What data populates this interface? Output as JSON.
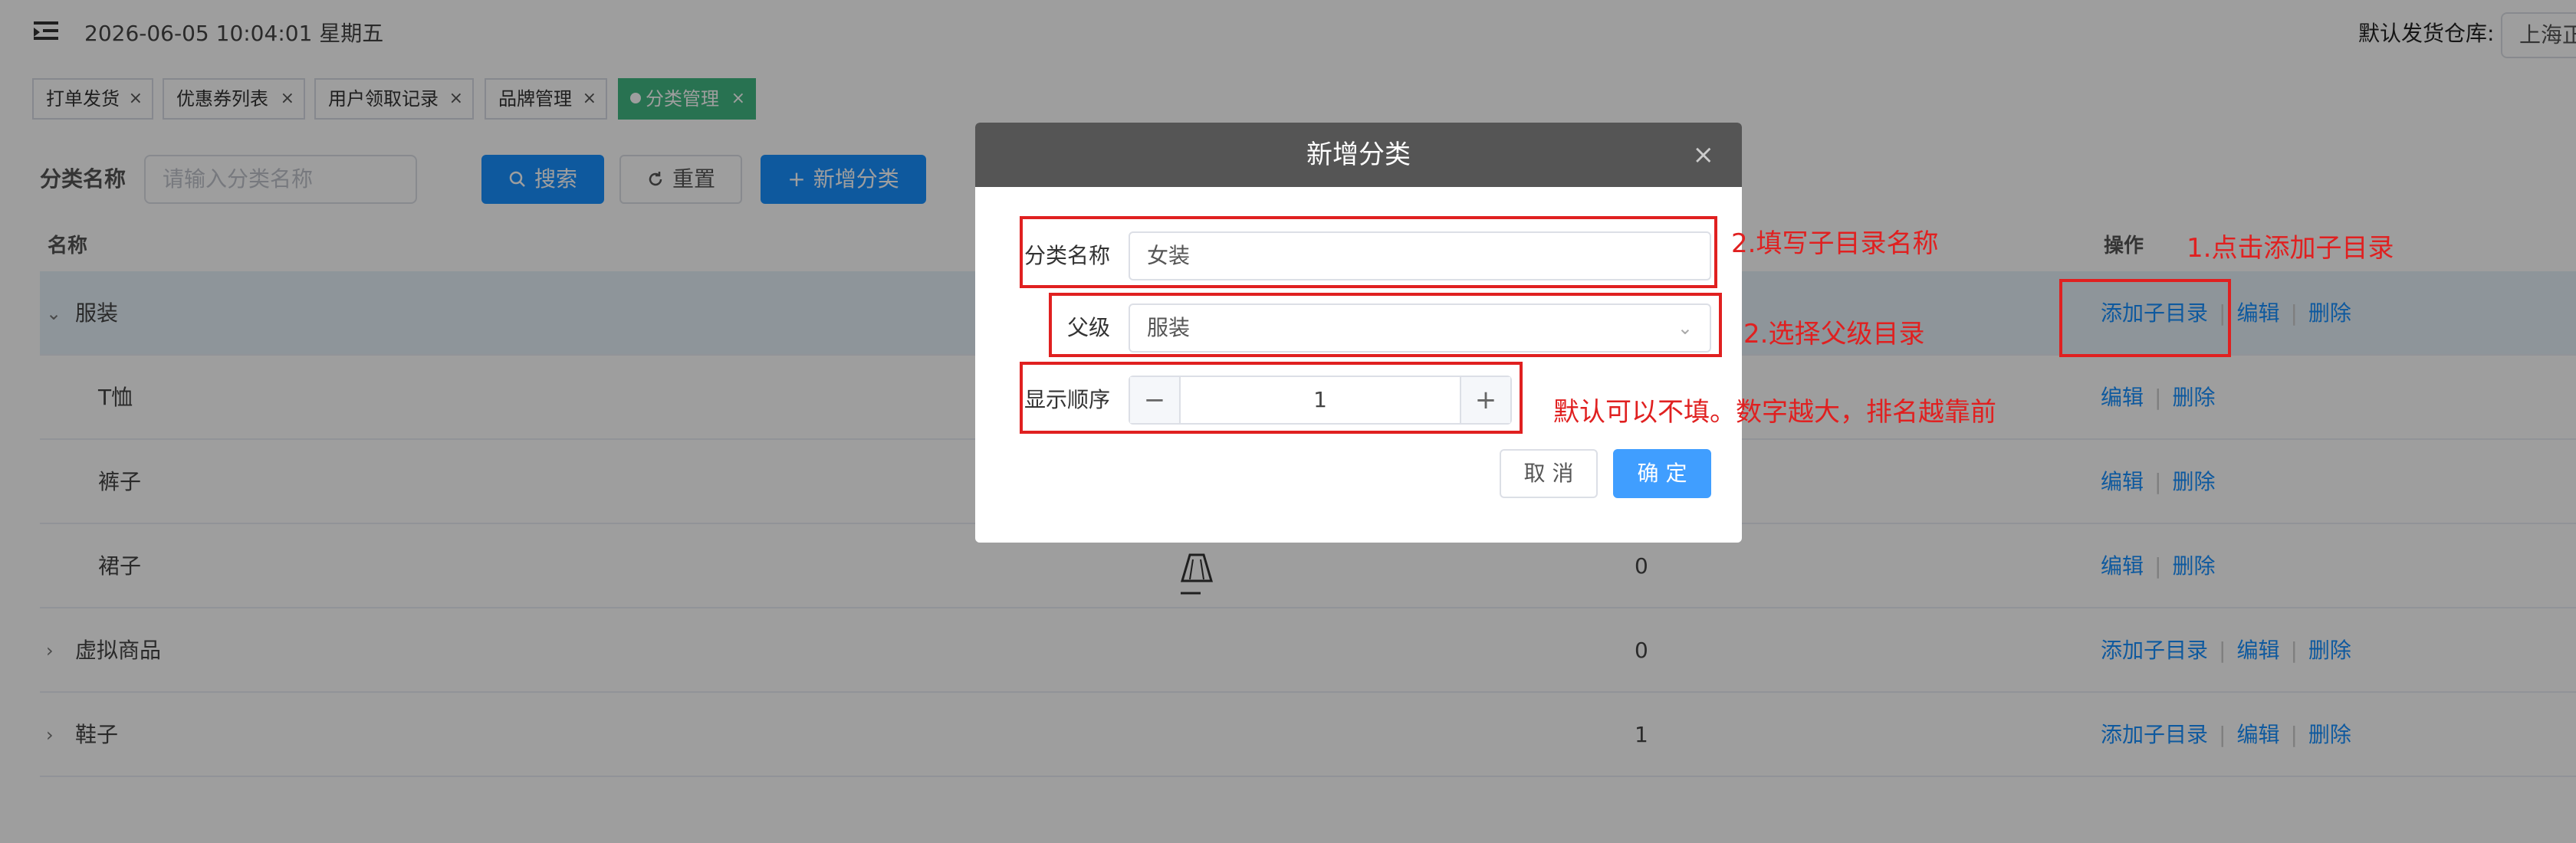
{
  "header": {
    "datetime": "2026-06-05 10:04:01 星期五",
    "warehouse_label": "默认发货仓库:",
    "warehouse_value": "上海正"
  },
  "tabs": [
    {
      "label": "打单发货",
      "close": "×"
    },
    {
      "label": "优惠券列表",
      "close": "×"
    },
    {
      "label": "用户领取记录",
      "close": "×"
    },
    {
      "label": "品牌管理",
      "close": "×"
    },
    {
      "label": "分类管理",
      "close": "×",
      "active": true
    }
  ],
  "filter": {
    "label": "分类名称",
    "placeholder": "请输入分类名称",
    "search_label": "搜索",
    "reset_label": "重置",
    "add_label": "新增分类"
  },
  "table": {
    "headers": {
      "name": "名称",
      "ops": "操作"
    },
    "rows": [
      {
        "name": "服装",
        "sort": "",
        "ops": [
          "添加子目录",
          "编辑",
          "删除"
        ]
      },
      {
        "name": "T恤",
        "sort": "",
        "ops": [
          "编辑",
          "删除"
        ]
      },
      {
        "name": "裤子",
        "sort": "",
        "ops": [
          "编辑",
          "删除"
        ]
      },
      {
        "name": "裙子",
        "sort": "0",
        "ops": [
          "编辑",
          "删除"
        ]
      },
      {
        "name": "虚拟商品",
        "sort": "0",
        "ops": [
          "添加子目录",
          "编辑",
          "删除"
        ]
      },
      {
        "name": "鞋子",
        "sort": "1",
        "ops": [
          "添加子目录",
          "编辑",
          "删除"
        ]
      }
    ]
  },
  "dialog": {
    "title": "新增分类",
    "close": "×",
    "name_label": "分类名称",
    "name_value": "女装",
    "parent_label": "父级",
    "parent_value": "服装",
    "order_label": "显示顺序",
    "order_value": "1",
    "minus": "−",
    "plus": "+",
    "cancel_label": "取 消",
    "confirm_label": "确 定"
  },
  "annotations": {
    "note_1": "1.点击添加子目录",
    "note_2a": "2.填写子目录名称",
    "note_2b": "2.选择父级目录",
    "note_3": "默认可以不填。数字越大，排名越靠前"
  },
  "colors": {
    "primary": "#1890ff",
    "tab_active": "#42b983",
    "annotation_red": "#e02020",
    "dialog_header": "#555555"
  }
}
